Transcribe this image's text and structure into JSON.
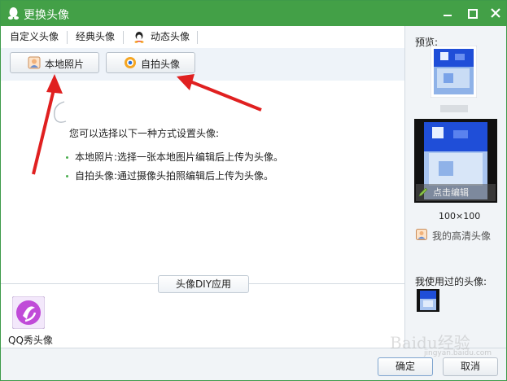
{
  "window": {
    "title": "更换头像"
  },
  "tabs": [
    {
      "label": "自定义头像"
    },
    {
      "label": "经典头像"
    },
    {
      "label": "动态头像"
    }
  ],
  "buttons": {
    "local_photo": "本地照片",
    "selfie": "自拍头像"
  },
  "main": {
    "intro": "您可以选择以下一种方式设置头像:",
    "items": [
      "本地照片:选择一张本地图片编辑后上传为头像。",
      "自拍头像:通过摄像头拍照编辑后上传为头像。"
    ]
  },
  "diy": {
    "label": "头像DIY应用",
    "app_label": "QQ秀头像"
  },
  "side": {
    "preview_label": "预览:",
    "edit_label": "点击编辑",
    "size_label": "100×100",
    "hd_label": "我的高清头像",
    "used_label": "我使用过的头像:"
  },
  "footer": {
    "ok": "确定",
    "cancel": "取消"
  },
  "watermark": {
    "text": "Baidu经验",
    "sub": "jingyan.baidu.com"
  },
  "colors": {
    "titlebar": "#43a047",
    "arrow": "#e02020"
  }
}
